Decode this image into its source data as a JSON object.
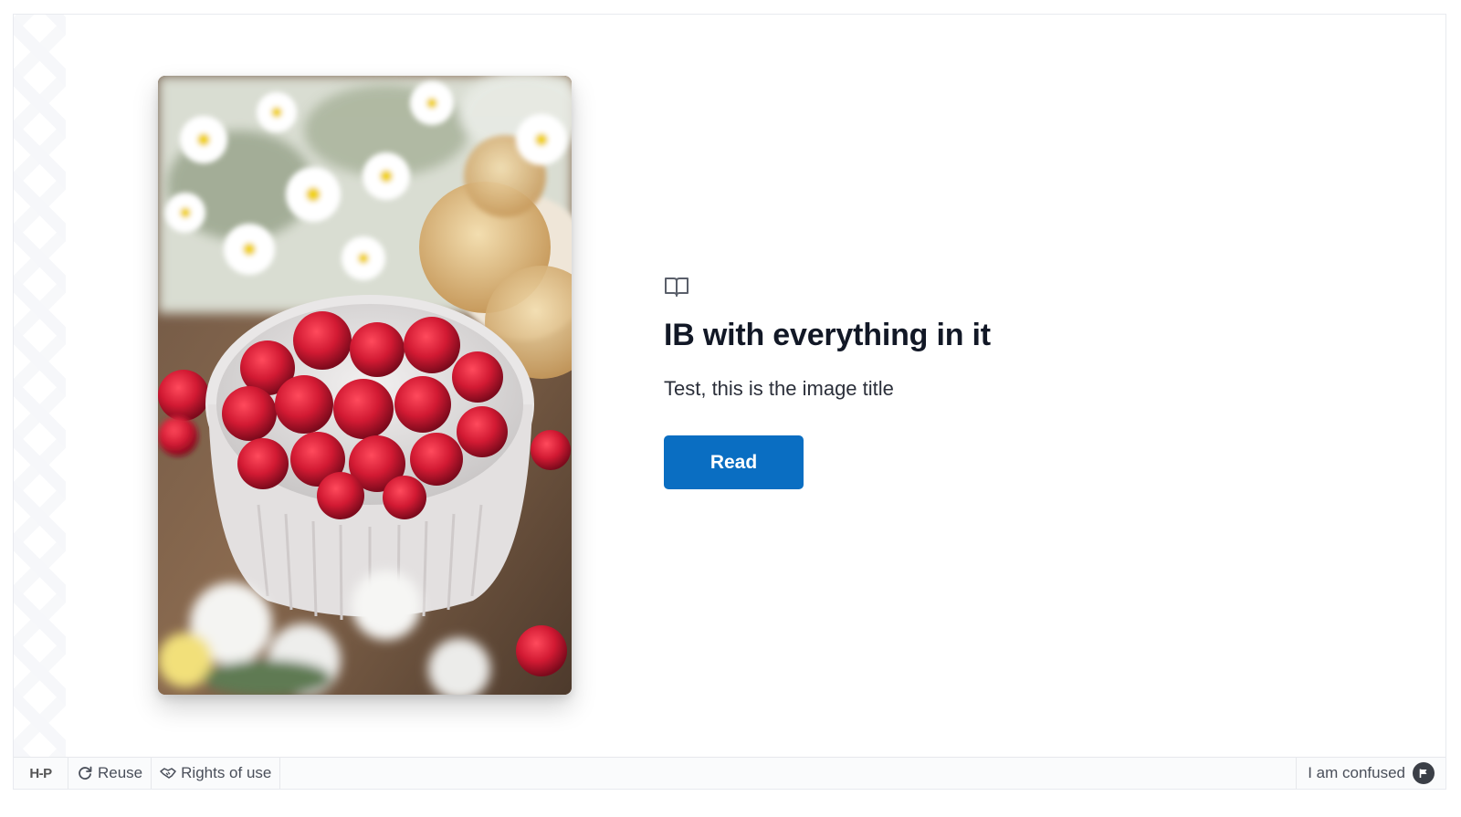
{
  "card": {
    "title": "IB with everything in it",
    "image_title": "Test, this is the image title",
    "read_label": "Read",
    "icon": "book-open-icon"
  },
  "footer": {
    "logo_text": "H-P",
    "reuse_label": "Reuse",
    "rights_label": "Rights of use",
    "confused_label": "I am confused"
  },
  "colors": {
    "accent": "#0a6ec2",
    "title_text": "#121826",
    "footer_bg": "#fafbfc"
  }
}
